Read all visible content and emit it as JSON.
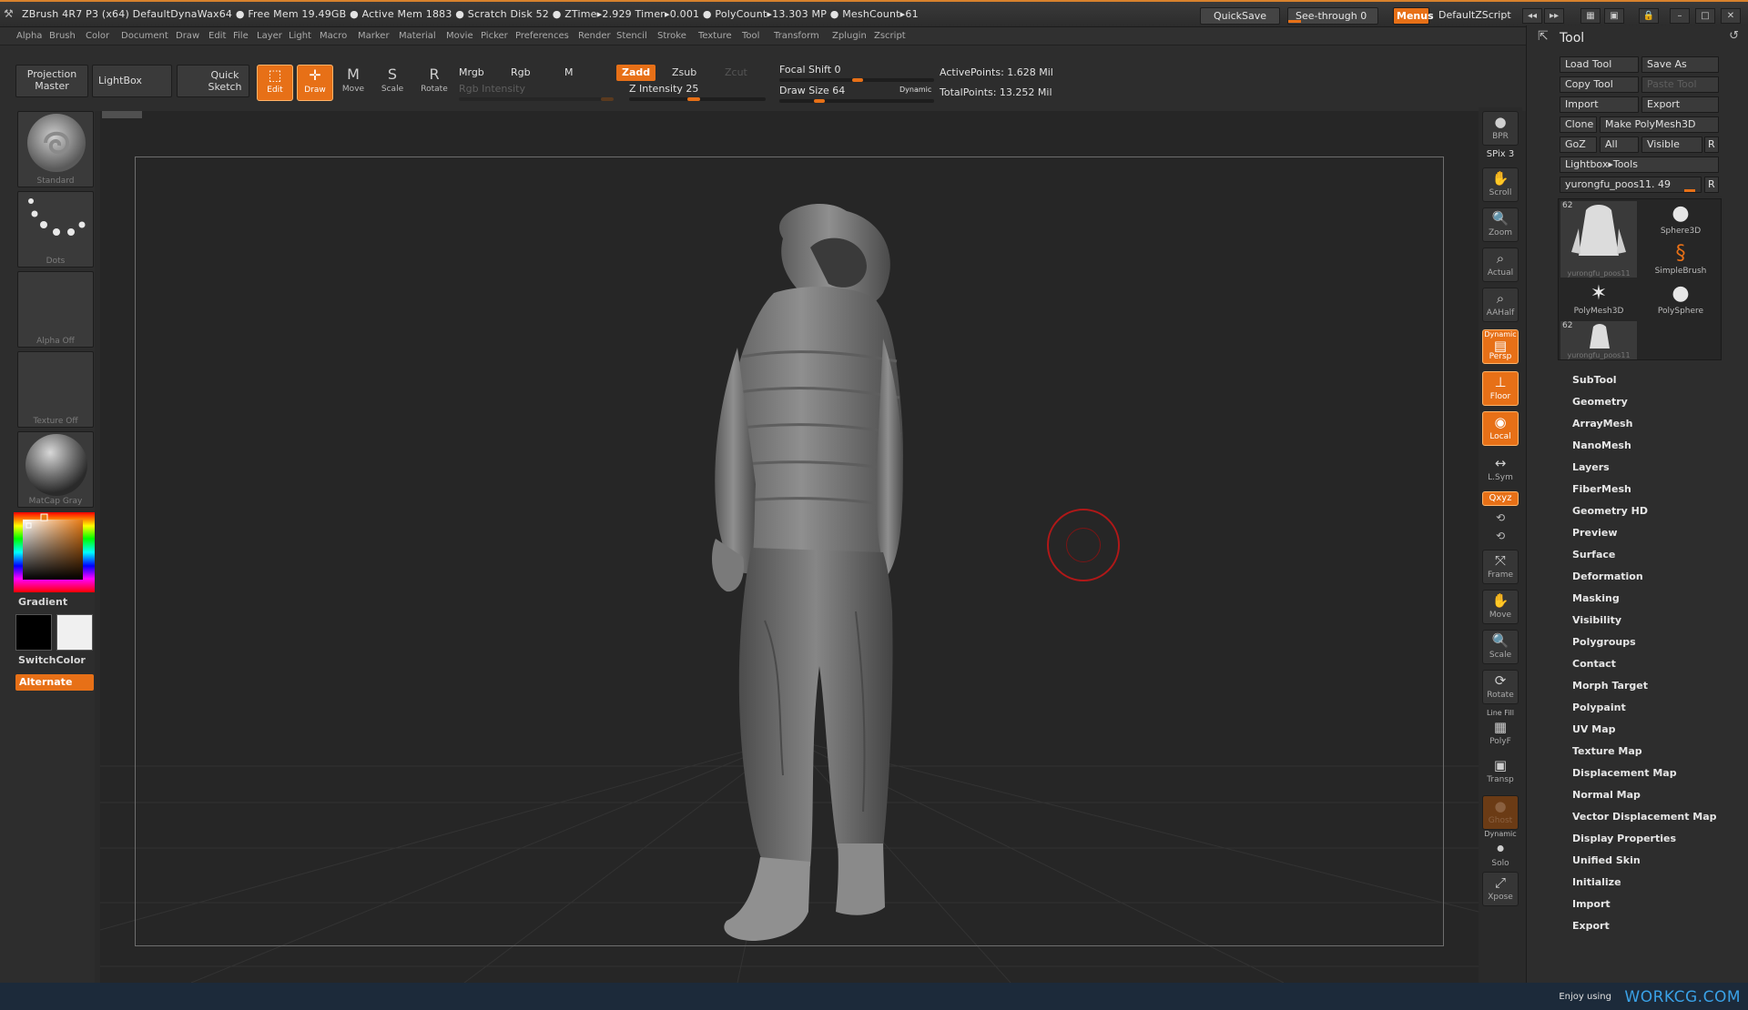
{
  "titlebar": {
    "info": "ZBrush 4R7 P3 (x64)   DefaultDynaWax64   ● Free Mem 19.49GB ● Active Mem 1883 ● Scratch Disk 52 ● ZTime▸2.929 Timer▸0.001 ● PolyCount▸13.303 MP ● MeshCount▸61",
    "quicksave": "QuickSave",
    "seethrough": "See-through  0",
    "menus": "Menus",
    "zscript": "DefaultZScript"
  },
  "menubar": [
    "Alpha",
    "Brush",
    "Color",
    "Document",
    "Draw",
    "Edit",
    "File",
    "Layer",
    "Light",
    "Macro",
    "Marker",
    "Material",
    "Movie",
    "Picker",
    "Preferences",
    "Render",
    "Stencil",
    "Stroke",
    "Texture",
    "Tool",
    "Transform",
    "Zplugin",
    "Zscript"
  ],
  "shelf": {
    "projection_master": "Projection Master",
    "lightbox": "LightBox",
    "quick_sketch": "Quick Sketch",
    "edit": "Edit",
    "draw": "Draw",
    "move": "Move",
    "scale": "Scale",
    "rotate": "Rotate",
    "mrgb": "Mrgb",
    "rgb": "Rgb",
    "m": "M",
    "rgb_intensity": "Rgb Intensity",
    "zadd": "Zadd",
    "zsub": "Zsub",
    "zcut": "Zcut",
    "z_intensity": "Z Intensity 25",
    "focal_shift": "Focal Shift 0",
    "draw_size": "Draw Size 64",
    "dynamic": "Dynamic",
    "active_points": "ActivePoints: 1.628  Mil",
    "total_points": "TotalPoints: 13.252  Mil"
  },
  "lefttray": {
    "brush": "Standard",
    "stroke": "Dots",
    "alpha": "Alpha Off",
    "texture": "Texture Off",
    "material": "MatCap Gray",
    "gradient": "Gradient",
    "switchcolor": "SwitchColor",
    "alternate": "Alternate"
  },
  "rightshelf": {
    "bpr": "BPR",
    "spix": "SPix 3",
    "scroll": "Scroll",
    "zoom": "Zoom",
    "actual": "Actual",
    "aahalf": "AAHalf",
    "dynamic": "Dynamic",
    "persp": "Persp",
    "floor": "Floor",
    "local": "Local",
    "lsym": "L.Sym",
    "xyz": "Qxyz",
    "frame": "Frame",
    "move": "Move",
    "scale": "Scale",
    "rotate": "Rotate",
    "linefill": "Line Fill",
    "polyf": "PolyF",
    "transp": "Transp",
    "ghost": "Ghost",
    "dynamic2": "Dynamic",
    "solo": "Solo",
    "xpose": "Xpose"
  },
  "toolpanel": {
    "title": "Tool",
    "load_tool": "Load Tool",
    "save_as": "Save As",
    "copy_tool": "Copy Tool",
    "paste_tool": "Paste Tool",
    "import": "Import",
    "export": "Export",
    "clone": "Clone",
    "make_polymesh": "Make PolyMesh3D",
    "goz": "GoZ",
    "all": "All",
    "visible": "Visible",
    "r": "R",
    "lightbox_tools": "Lightbox▸Tools",
    "current_tool": "yurongfu_poos11. 49",
    "r2": "R",
    "thumbs": [
      {
        "label": "yurongfu_poos11",
        "count": "62"
      },
      {
        "label": "Sphere3D"
      },
      {
        "label": "SimpleBrush"
      },
      {
        "label": "PolyMesh3D"
      },
      {
        "label": "PolySphere"
      },
      {
        "label": "yurongfu_poos11",
        "count": "62"
      }
    ],
    "subpalettes": [
      "SubTool",
      "Geometry",
      "ArrayMesh",
      "NanoMesh",
      "Layers",
      "FiberMesh",
      "Geometry HD",
      "Preview",
      "Surface",
      "Deformation",
      "Masking",
      "Visibility",
      "Polygroups",
      "Contact",
      "Morph Target",
      "Polypaint",
      "UV Map",
      "Texture Map",
      "Displacement Map",
      "Normal Map",
      "Vector Displacement Map",
      "Display Properties",
      "Unified Skin",
      "Initialize",
      "Import",
      "Export"
    ]
  },
  "footer": {
    "enjoy": "Enjoy using",
    "site": "WORKCG.COM"
  },
  "colors": {
    "accent": "#e77017",
    "bg": "#2a2a2a",
    "canvas": "#262626",
    "footer_link": "#3aa1e6"
  }
}
